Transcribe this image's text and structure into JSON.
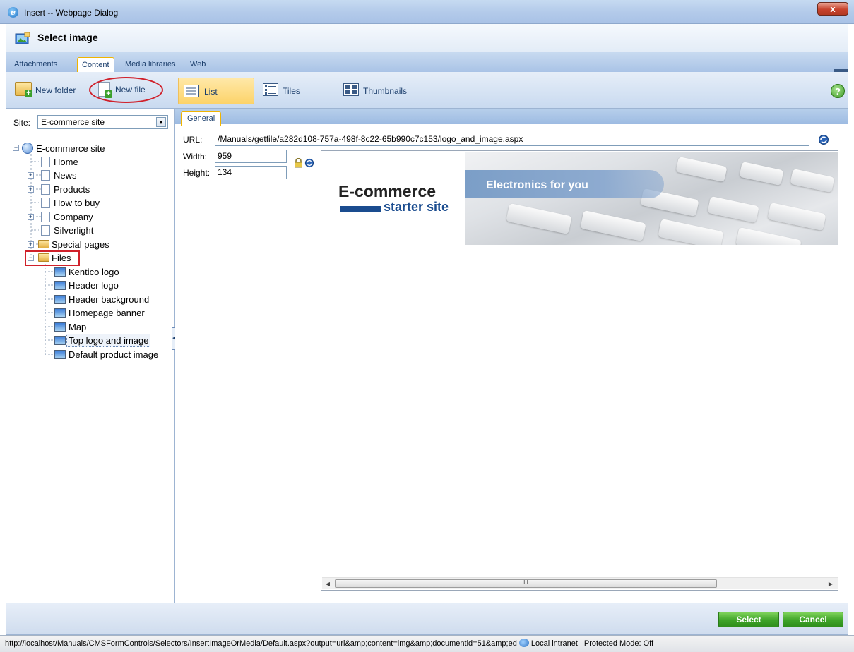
{
  "window": {
    "title": "Insert -- Webpage Dialog",
    "close_label": "x"
  },
  "header": {
    "title": "Select image"
  },
  "tabs": [
    {
      "label": "Attachments",
      "active": false
    },
    {
      "label": "Content",
      "active": true
    },
    {
      "label": "Media libraries",
      "active": false
    },
    {
      "label": "Web",
      "active": false
    }
  ],
  "left_toolbar": {
    "new_folder": "New folder",
    "new_file": "New file"
  },
  "view_modes": [
    {
      "label": "List",
      "active": true
    },
    {
      "label": "Tiles",
      "active": false
    },
    {
      "label": "Thumbnails",
      "active": false
    }
  ],
  "help_label": "?",
  "site": {
    "label": "Site:",
    "value": "E-commerce site"
  },
  "tree": {
    "root": "E-commerce site",
    "nodes": [
      {
        "label": "Home",
        "icon": "page-icon",
        "expandable": false
      },
      {
        "label": "News",
        "icon": "page-icon",
        "expandable": true
      },
      {
        "label": "Products",
        "icon": "page-icon",
        "expandable": true
      },
      {
        "label": "How to buy",
        "icon": "page-icon",
        "expandable": false
      },
      {
        "label": "Company",
        "icon": "page-icon",
        "expandable": true
      },
      {
        "label": "Silverlight",
        "icon": "page-icon",
        "expandable": false
      },
      {
        "label": "Special pages",
        "icon": "folder-icon",
        "expandable": true
      },
      {
        "label": "Files",
        "icon": "folder-icon",
        "expandable": true,
        "expanded": true
      }
    ],
    "files_children": [
      {
        "label": "Kentico logo",
        "icon": "image-icon"
      },
      {
        "label": "Header logo",
        "icon": "image-icon"
      },
      {
        "label": "Header background",
        "icon": "image-icon"
      },
      {
        "label": "Homepage banner",
        "icon": "image-icon"
      },
      {
        "label": "Map",
        "icon": "image-icon"
      },
      {
        "label": "Top logo and image",
        "icon": "image-icon",
        "selected": true
      },
      {
        "label": "Default product image",
        "icon": "image-icon"
      }
    ]
  },
  "properties": {
    "tab": "General",
    "url_label": "URL:",
    "url_value": "/Manuals/getfile/a282d108-757a-498f-8c22-65b990c7c153/logo_and_image.aspx",
    "width_label": "Width:",
    "width_value": "959",
    "height_label": "Height:",
    "height_value": "134"
  },
  "preview": {
    "logo_title": "E-commerce",
    "logo_subtitle": "starter site",
    "banner_text": "Electronics for you",
    "scroll_thumb_grip": "III"
  },
  "footer": {
    "select": "Select",
    "cancel": "Cancel"
  },
  "status": {
    "url": "http://localhost/Manuals/CMSFormControls/Selectors/InsertImageOrMedia/Default.aspx?output=url&amp;content=img&amp;documentid=51&amp;ed",
    "zone": "Local intranet | Protected Mode: Off"
  },
  "colors": {
    "accent": "#f0b400",
    "button_green": "#3ea328",
    "highlight_red": "#d0202a"
  }
}
